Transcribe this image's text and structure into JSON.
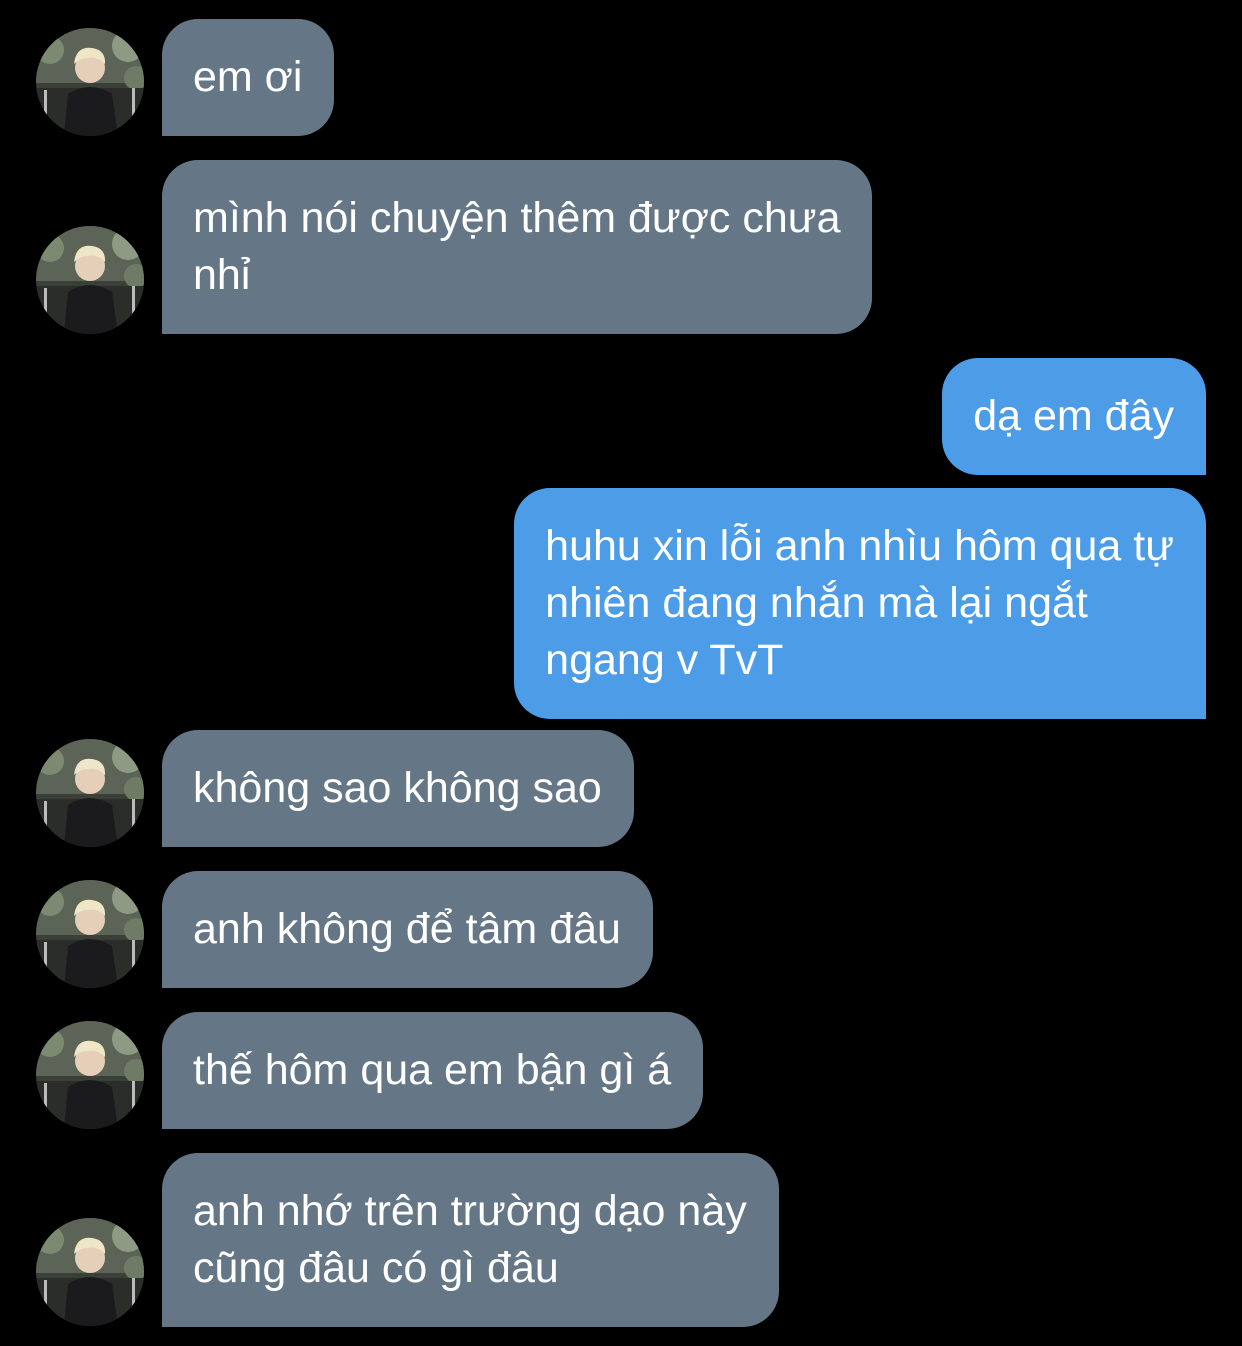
{
  "colors": {
    "background": "#000000",
    "incoming_bubble": "#657786",
    "outgoing_bubble": "#4c9ce8",
    "text": "#ffffff"
  },
  "avatar": {
    "icon": "user-avatar-photo"
  },
  "messages": [
    {
      "direction": "incoming",
      "lines": [
        "em ơi"
      ]
    },
    {
      "direction": "incoming",
      "lines": [
        "mình nói chuyện thêm được chưa",
        "nhỉ"
      ]
    },
    {
      "direction": "outgoing",
      "lines": [
        "dạ em đây"
      ]
    },
    {
      "direction": "outgoing",
      "lines": [
        "huhu xin lỗi anh nhìu hôm qua tự",
        "nhiên đang nhắn mà lại ngắt",
        "ngang v TvT"
      ]
    },
    {
      "direction": "incoming",
      "lines": [
        "không sao không sao"
      ]
    },
    {
      "direction": "incoming",
      "lines": [
        "anh không để tâm đâu"
      ]
    },
    {
      "direction": "incoming",
      "lines": [
        "thế hôm qua em bận gì á"
      ]
    },
    {
      "direction": "incoming",
      "lines": [
        "anh nhớ trên trường dạo này",
        "cũng đâu có gì đâu"
      ]
    }
  ]
}
